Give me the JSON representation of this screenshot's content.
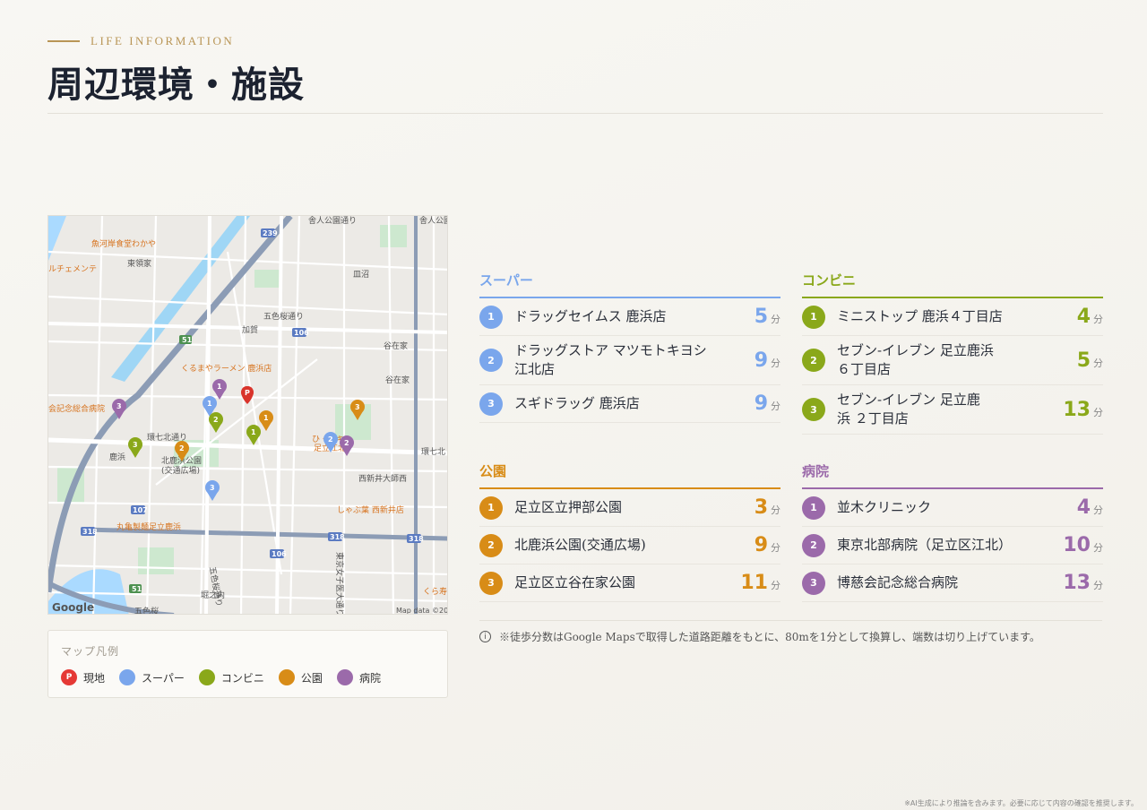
{
  "header": {
    "eyebrow": "LIFE INFORMATION",
    "title": "周辺環境・施設"
  },
  "map": {
    "labels": [
      "魚河岸食堂わかや",
      "東領家",
      "ルチェメンテ",
      "皿沼",
      "五色桜通り",
      "加賀",
      "谷在家",
      "谷在家",
      "くるまやラーメン 鹿浜店",
      "会記念総合病院",
      "環七北通り",
      "鹿浜",
      "北鹿浜公園",
      "(交通広場)",
      "西新井大師西",
      "しゃぶ葉 西新井店",
      "丸亀製麺足立鹿浜",
      "五色桜通り",
      "東京女子医大通り",
      "堀之内",
      "五色桜",
      "くら寿",
      "舎人公園通り",
      "舎人公園",
      "環七北",
      "足立江北",
      "ひ・ンキー"
    ],
    "road_numbers": [
      "239",
      "51",
      "106",
      "107",
      "318",
      "318",
      "318",
      "106",
      "51"
    ],
    "attribution": "Map data ©2026",
    "logo": "Google",
    "pin_numbers": [
      "P",
      "1",
      "1",
      "1",
      "2",
      "2",
      "2",
      "3",
      "3",
      "3",
      "1",
      "2",
      "3"
    ]
  },
  "legend": {
    "title": "マップ凡例",
    "items": [
      {
        "icon": "P",
        "label": "現地",
        "color": "#e53935"
      },
      {
        "label": "スーパー",
        "color": "#7aa6ec"
      },
      {
        "label": "コンビニ",
        "color": "#8aa81a"
      },
      {
        "label": "公園",
        "color": "#d88c17"
      },
      {
        "label": "病院",
        "color": "#9b6aaa"
      }
    ]
  },
  "categories": {
    "super": {
      "title": "スーパー",
      "items": [
        {
          "n": "1",
          "name": "ドラッグセイムス 鹿浜店",
          "time": "5",
          "unit": "分"
        },
        {
          "n": "2",
          "name": "ドラッグストア マツモトキヨシ 江北店",
          "time": "9",
          "unit": "分"
        },
        {
          "n": "3",
          "name": "スギドラッグ 鹿浜店",
          "time": "9",
          "unit": "分"
        }
      ]
    },
    "conbini": {
      "title": "コンビニ",
      "items": [
        {
          "n": "1",
          "name": "ミニストップ 鹿浜４丁目店",
          "time": "4",
          "unit": "分"
        },
        {
          "n": "2",
          "name": "セブン-イレブン 足立鹿浜 ６丁目店",
          "time": "5",
          "unit": "分"
        },
        {
          "n": "3",
          "name": "セブン-イレブン 足立鹿浜 ２丁目店",
          "time": "13",
          "unit": "分"
        }
      ]
    },
    "park": {
      "title": "公園",
      "items": [
        {
          "n": "1",
          "name": "足立区立押部公園",
          "time": "3",
          "unit": "分"
        },
        {
          "n": "2",
          "name": "北鹿浜公園(交通広場)",
          "time": "9",
          "unit": "分"
        },
        {
          "n": "3",
          "name": "足立区立谷在家公園",
          "time": "11",
          "unit": "分"
        }
      ]
    },
    "hospital": {
      "title": "病院",
      "items": [
        {
          "n": "1",
          "name": "並木クリニック",
          "time": "4",
          "unit": "分"
        },
        {
          "n": "2",
          "name": "東京北部病院（足立区江北）",
          "time": "10",
          "unit": "分"
        },
        {
          "n": "3",
          "name": "博慈会記念総合病院",
          "time": "13",
          "unit": "分"
        }
      ]
    }
  },
  "note": {
    "icon": "i",
    "text": "※徒歩分数はGoogle Mapsで取得した道路距離をもとに、80mを1分として換算し、端数は切り上げています。"
  },
  "footer": "※AI生成により推論を含みます。必要に応じて内容の確認を推奨します。"
}
